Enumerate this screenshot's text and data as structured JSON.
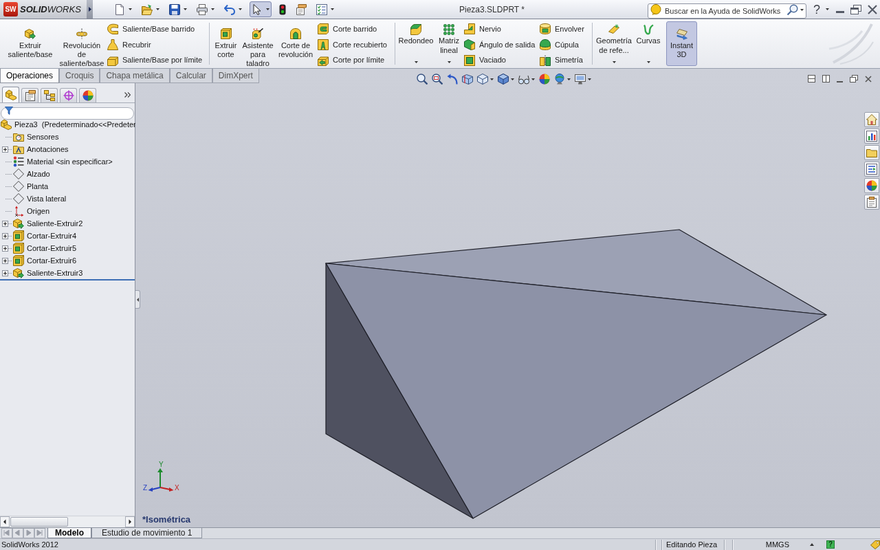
{
  "title_bar": {
    "logo": {
      "badge": "SW",
      "wordmark": "**SOLID**WORKS"
    },
    "quick_access": [
      {
        "kind": "new",
        "dropdown": true,
        "pressed": false
      },
      {
        "kind": "open",
        "dropdown": true,
        "pressed": false
      },
      {
        "kind": "save",
        "dropdown": true,
        "pressed": false
      },
      {
        "kind": "print",
        "dropdown": true,
        "pressed": false
      },
      {
        "kind": "undo",
        "dropdown": true,
        "pressed": false
      },
      {
        "kind": "select",
        "dropdown": true,
        "pressed": true
      },
      {
        "kind": "rebuild",
        "dropdown": false,
        "pressed": false
      },
      {
        "kind": "file_properties",
        "dropdown": false,
        "pressed": false
      },
      {
        "kind": "options",
        "dropdown": true,
        "pressed": false
      }
    ],
    "title": "Pieza3.SLDPRT *",
    "search": {
      "placeholder": "Buscar en la Ayuda de SolidWorks"
    },
    "help": "?"
  },
  "ribbon": {
    "groups": [
      {
        "items": [
          {
            "kind": "large",
            "lines": [
              "Extruir",
              "saliente/base"
            ]
          },
          {
            "kind": "large",
            "lines": [
              "Revolución",
              "de",
              "saliente/base"
            ]
          },
          {
            "kind": "stack",
            "items": [
              {
                "label": "Saliente/Base barrido"
              },
              {
                "label": "Recubrir"
              },
              {
                "label": "Saliente/Base por límite"
              }
            ]
          }
        ]
      },
      {
        "items": [
          {
            "kind": "large",
            "lines": [
              "Extruir",
              "corte"
            ]
          },
          {
            "kind": "large",
            "lines": [
              "Asistente",
              "para",
              "taladro"
            ]
          },
          {
            "kind": "large",
            "lines": [
              "Corte de",
              "revolución"
            ]
          },
          {
            "kind": "stack",
            "items": [
              {
                "label": "Corte barrido"
              },
              {
                "label": "Corte recubierto"
              },
              {
                "label": "Corte por límite"
              }
            ]
          }
        ]
      },
      {
        "items": [
          {
            "kind": "split",
            "lines": [
              "Redondeo"
            ]
          },
          {
            "kind": "split",
            "lines": [
              "Matriz",
              "lineal"
            ]
          },
          {
            "kind": "stack",
            "items": [
              {
                "label": "Nervio"
              },
              {
                "label": "Ángulo de salida"
              },
              {
                "label": "Vaciado"
              }
            ]
          },
          {
            "kind": "stack",
            "items": [
              {
                "label": "Envolver"
              },
              {
                "label": "Cúpula"
              },
              {
                "label": "Simetría"
              }
            ]
          }
        ]
      },
      {
        "items": [
          {
            "kind": "split",
            "lines": [
              "Geometría",
              "de refe..."
            ]
          },
          {
            "kind": "split",
            "lines": [
              "Curvas"
            ]
          },
          {
            "kind": "toggle",
            "lines": [
              "Instant",
              "3D"
            ],
            "on": true
          }
        ]
      }
    ]
  },
  "command_tabs": [
    {
      "label": "Operaciones",
      "selected": true
    },
    {
      "label": "Croquis",
      "selected": false
    },
    {
      "label": "Chapa metálica",
      "selected": false
    },
    {
      "label": "Calcular",
      "selected": false
    },
    {
      "label": "DimXpert",
      "selected": false
    }
  ],
  "feature_manager": {
    "tabs": [
      {
        "kind": "feature_manager",
        "selected": true
      },
      {
        "kind": "property_manager",
        "selected": false
      },
      {
        "kind": "configuration_manager",
        "selected": false
      },
      {
        "kind": "dimxpert_manager",
        "selected": false
      },
      {
        "kind": "display_manager",
        "selected": false
      }
    ],
    "tree": [
      {
        "kind": "part",
        "label": "Pieza3  (Predeterminado<<Predeter",
        "children": [
          {
            "kind": "sensors",
            "label": "Sensores"
          },
          {
            "kind": "annotations",
            "label": "Anotaciones",
            "expanded": false
          },
          {
            "kind": "material",
            "label": "Material <sin especificar>"
          },
          {
            "kind": "plane",
            "label": "Alzado"
          },
          {
            "kind": "plane",
            "label": "Planta"
          },
          {
            "kind": "plane",
            "label": "Vista lateral"
          },
          {
            "kind": "origin",
            "label": "Origen"
          },
          {
            "kind": "boss",
            "label": "Saliente-Extruir2",
            "expanded": false
          },
          {
            "kind": "cut",
            "label": "Cortar-Extruir4",
            "expanded": false
          },
          {
            "kind": "cut",
            "label": "Cortar-Extruir5",
            "expanded": false
          },
          {
            "kind": "cut",
            "label": "Cortar-Extruir6",
            "expanded": false
          },
          {
            "kind": "boss",
            "label": "Saliente-Extruir3",
            "expanded": false
          }
        ]
      }
    ]
  },
  "viewport": {
    "view_name": "*Isométrica",
    "triad": {
      "x": "X",
      "y": "Y",
      "z": "Z"
    }
  },
  "bottom_tabs": [
    {
      "label": "Modelo",
      "selected": true
    },
    {
      "label": "Estudio de movimiento 1",
      "selected": false
    }
  ],
  "status_bar": {
    "app": "SolidWorks 2012",
    "mode": "Editando Pieza",
    "units": "MMGS",
    "help": "?"
  }
}
